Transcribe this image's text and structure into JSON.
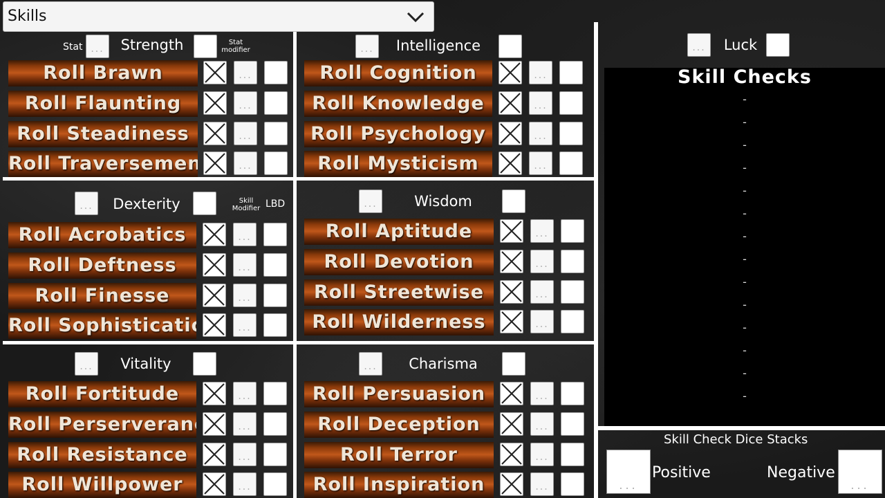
{
  "header": {
    "title": "Skills"
  },
  "labels": {
    "stat": "Stat",
    "stat_modifier": "Stat modifier",
    "skill_modifier": "Skill Modifier",
    "lbd": "LBD",
    "luck": "Luck",
    "skill_checks_title": "Skill Checks",
    "dice_stacks_title": "Skill Check Dice Stacks",
    "positive": "Positive",
    "negative": "Negative"
  },
  "placeholder_dots": "...",
  "check_lines": [
    "-",
    "-",
    "-",
    "-",
    "-",
    "-",
    "-",
    "-",
    "-",
    "-",
    "-",
    "-",
    "-",
    "-"
  ],
  "sections": {
    "strength": {
      "name": "Strength",
      "skills": [
        "Roll Brawn",
        "Roll Flaunting",
        "Roll Steadiness",
        "Roll Traversement"
      ]
    },
    "intelligence": {
      "name": "Intelligence",
      "skills": [
        "Roll Cognition",
        "Roll Knowledge",
        "Roll Psychology",
        "Roll Mysticism"
      ]
    },
    "dexterity": {
      "name": "Dexterity",
      "skills": [
        "Roll Acrobatics",
        "Roll Deftness",
        "Roll Finesse",
        "Roll Sophistication"
      ]
    },
    "wisdom": {
      "name": "Wisdom",
      "skills": [
        "Roll Aptitude",
        "Roll Devotion",
        "Roll Streetwise",
        "Roll Wilderness"
      ]
    },
    "vitality": {
      "name": "Vitality",
      "skills": [
        "Roll Fortitude",
        "Roll Perserverance",
        "Roll Resistance",
        "Roll Willpower"
      ]
    },
    "charisma": {
      "name": "Charisma",
      "skills": [
        "Roll Persuasion",
        "Roll Deception",
        "Roll Terror",
        "Roll Inspiration"
      ]
    }
  }
}
